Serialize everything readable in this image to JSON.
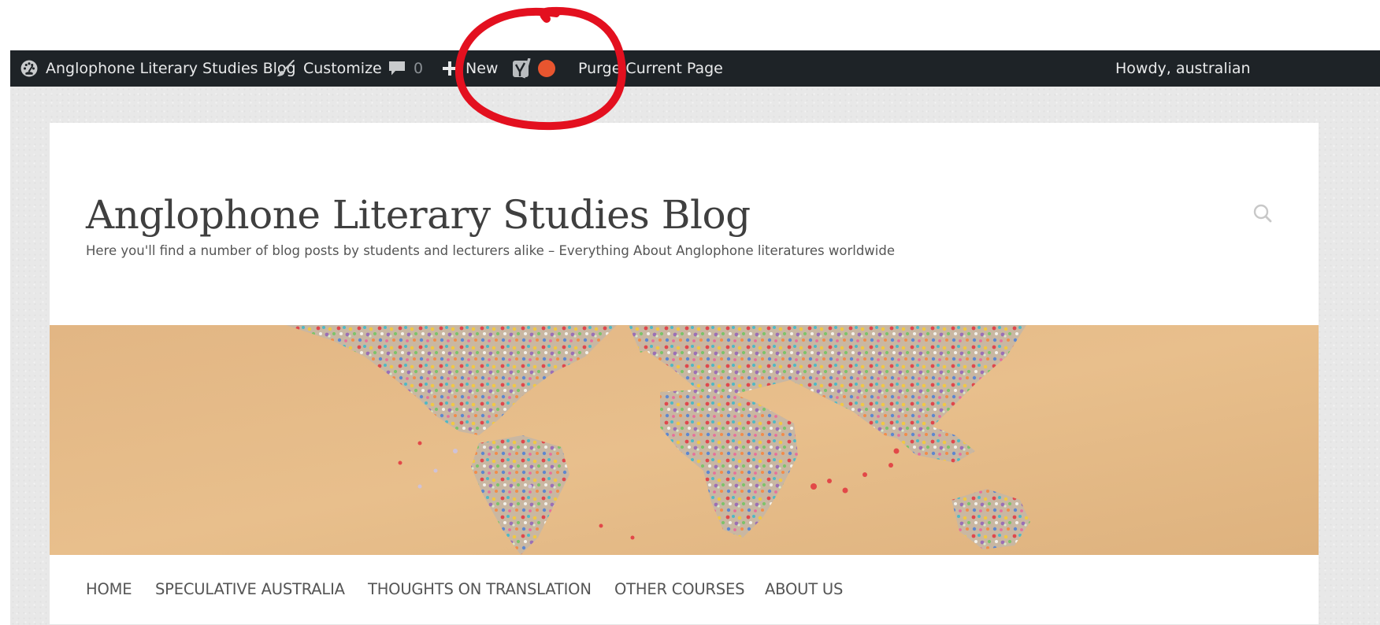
{
  "admin_bar": {
    "site_name": "Anglophone Literary Studies Blog",
    "customize_label": "Customize",
    "comments_count": "0",
    "new_label": "New",
    "purge_label": "Purge Current Page",
    "greeting": "Howdy, australian",
    "icons": {
      "dashboard": "dashboard-icon",
      "customize": "paintbrush-icon",
      "comments": "comment-bubble-icon",
      "new": "plus-icon",
      "seo": "yoast-seo-icon",
      "seo_status": "status-dot-icon"
    },
    "colors": {
      "background": "#1e2327",
      "text": "#e9eaeb",
      "status_dot": "#e8552f"
    }
  },
  "site": {
    "title": "Anglophone Literary Studies Blog",
    "tagline": "Here you'll find a number of blog posts by students and lecturers alike – Everything About Anglophone literatures worldwide"
  },
  "header": {
    "search_icon": "search-icon",
    "banner": "world-map-banner"
  },
  "nav": {
    "items": [
      {
        "label": "HOME"
      },
      {
        "label": "SPECULATIVE AUSTRALIA"
      },
      {
        "label": "THOUGHTS ON TRANSLATION"
      },
      {
        "label": "OTHER COURSES"
      },
      {
        "label": "ABOUT US"
      }
    ]
  },
  "annotation": {
    "shape": "red-circle",
    "target": "new-button",
    "color": "#e3101f"
  }
}
